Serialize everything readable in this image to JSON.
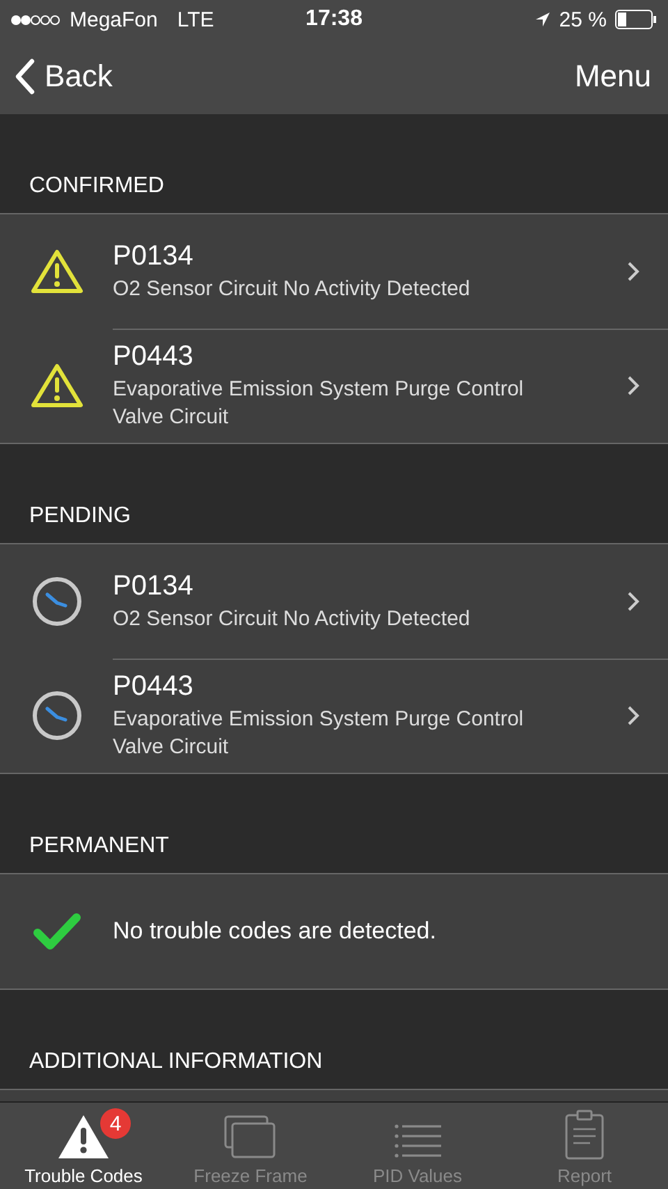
{
  "status_bar": {
    "carrier": "MegaFon",
    "network": "LTE",
    "time": "17:38",
    "battery": "25 %"
  },
  "nav": {
    "back": "Back",
    "menu": "Menu"
  },
  "sections": [
    {
      "title": "CONFIRMED",
      "items": [
        {
          "kind": "warning",
          "code": "P0134",
          "description": "O2 Sensor Circuit No Activity Detected"
        },
        {
          "kind": "warning",
          "code": "P0443",
          "description": "Evaporative Emission System Purge Control Valve Circuit"
        }
      ]
    },
    {
      "title": "PENDING",
      "items": [
        {
          "kind": "clock",
          "code": "P0134",
          "description": "O2 Sensor Circuit No Activity Detected"
        },
        {
          "kind": "clock",
          "code": "P0443",
          "description": "Evaporative Emission System Purge Control Valve Circuit"
        }
      ]
    },
    {
      "title": "PERMANENT",
      "items": [
        {
          "kind": "ok",
          "message": "No trouble codes are detected."
        }
      ]
    },
    {
      "title": "ADDITIONAL INFORMATION"
    }
  ],
  "tabs": [
    {
      "kind": "warning",
      "label": "Trouble Codes",
      "selected": true,
      "badge": "4"
    },
    {
      "kind": "frames",
      "label": "Freeze Frame",
      "selected": false
    },
    {
      "kind": "list",
      "label": "PID Values",
      "selected": false
    },
    {
      "kind": "report",
      "label": "Report",
      "selected": false
    }
  ]
}
